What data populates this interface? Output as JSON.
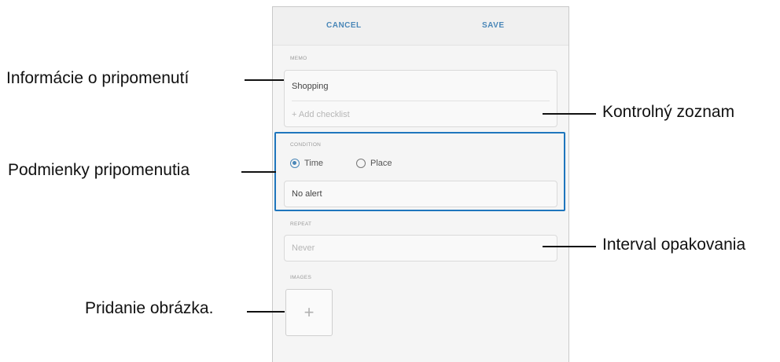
{
  "app": {
    "cancel_label": "CANCEL",
    "save_label": "SAVE"
  },
  "memo": {
    "section_label": "MEMO",
    "value": "Shopping",
    "checklist_hint": "+  Add checklist"
  },
  "condition": {
    "section_label": "CONDITION",
    "option_time": "Time",
    "option_place": "Place",
    "selected": "Time",
    "alert_value": "No alert"
  },
  "repeat": {
    "section_label": "REPEAT",
    "value": "Never"
  },
  "images": {
    "section_label": "IMAGES",
    "add_symbol": "+"
  },
  "callouts": {
    "reminder_info": "Informácie o pripomenutí",
    "checklist": "Kontrolný zoznam",
    "conditions": "Podmienky pripomenutia",
    "repeat_interval": "Interval opakovania",
    "add_image": "Pridanie obrázka."
  },
  "colors": {
    "accent": "#4a87b8",
    "highlight_border": "#1f76bd"
  }
}
